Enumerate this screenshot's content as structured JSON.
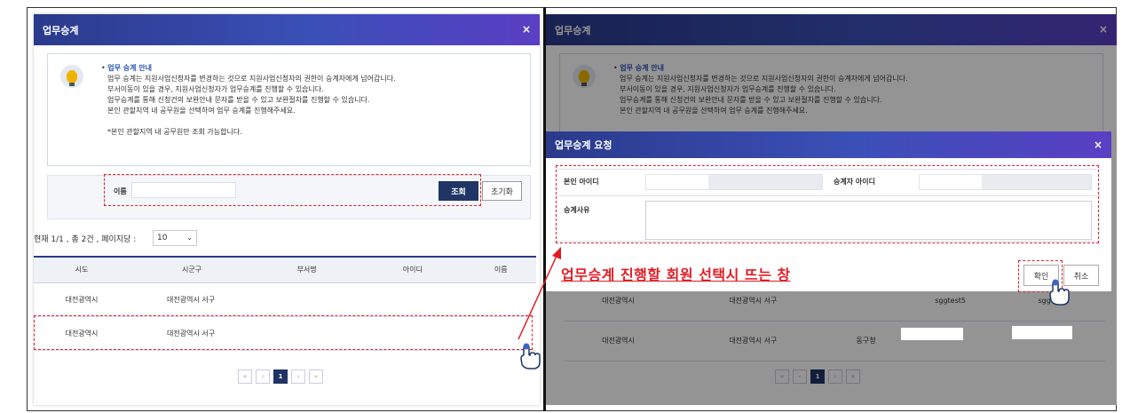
{
  "left": {
    "title": "업무승계",
    "close": "×",
    "notice": {
      "heading": "업무 승계 안내",
      "lines": [
        "업무 승계는 지원사업신청자를 변경하는 것으로 지원사업신청자의 권한이 승계자에게 넘어갑니다.",
        "부서이동이 있을 경우, 지원사업신청자가 업무승계를 진행할 수 있습니다.",
        "업무승계를 통해 신청건의 보완안내 문자를 받을 수 있고 보완절차를 진행할 수 있습니다.",
        "본인 관할지역 내 공무원을 선택하여 업무 승계를 진행해주세요."
      ],
      "footnote": "*본인 관할지역 내 공무원만 조회 가능합니다."
    },
    "search": {
      "name_label": "이름",
      "search_btn": "조회",
      "reset_btn": "초기화"
    },
    "page_info": "현재 1/1 , 총 2건 , 페이지당 :",
    "per_page": "10",
    "columns": [
      "시도",
      "시군구",
      "부서명",
      "아이디",
      "이름"
    ],
    "rows": [
      {
        "sido": "대전광역시",
        "sigungu": "대전광역시 서구"
      },
      {
        "sido": "대전광역시",
        "sigungu": "대전광역시 서구"
      }
    ],
    "pager": [
      "«",
      "‹",
      "1",
      "›",
      "»"
    ]
  },
  "right": {
    "title": "업무승계",
    "close": "×",
    "notice_heading": "업무 승계 안내",
    "notice_lines": [
      "업무 승계는 지원사업신청자를 변경하는 것으로 지원사업신청자의 권한이 승계자에게 넘어갑니다.",
      "부서이동이 있을 경우, 지원사업신청자가 업무승계를 진행할 수 있습니다.",
      "업무승계를 통해 신청건의 보완안내 문자를 받을 수 있고 보완절차를 진행할 수 있습니다.",
      "본인 관할지역 내 공무원을 선택하여 업무 승계를 진행해주세요."
    ],
    "row1": {
      "sido": "대전광역시",
      "sigungu": "대전광역시 서구",
      "id": "sggtest5",
      "name": "sggtest5"
    },
    "row2": {
      "sido": "대전광역시",
      "sigungu": "대전광역시 서구",
      "dept": "동구청"
    },
    "pager": [
      "«",
      "‹",
      "1",
      "›",
      "»"
    ]
  },
  "modal": {
    "title": "업무승계 요청",
    "close": "×",
    "my_id_label": "본인 아이디",
    "successor_id_label": "승계자 아이디",
    "reason_label": "승계사유",
    "ok_btn": "확인",
    "cancel_btn": "취소"
  },
  "caption": "업무승계 진행할 회원 선택시 뜨는 창",
  "colors": {
    "accent": "#2a3a8c",
    "highlight": "#d8232a"
  }
}
